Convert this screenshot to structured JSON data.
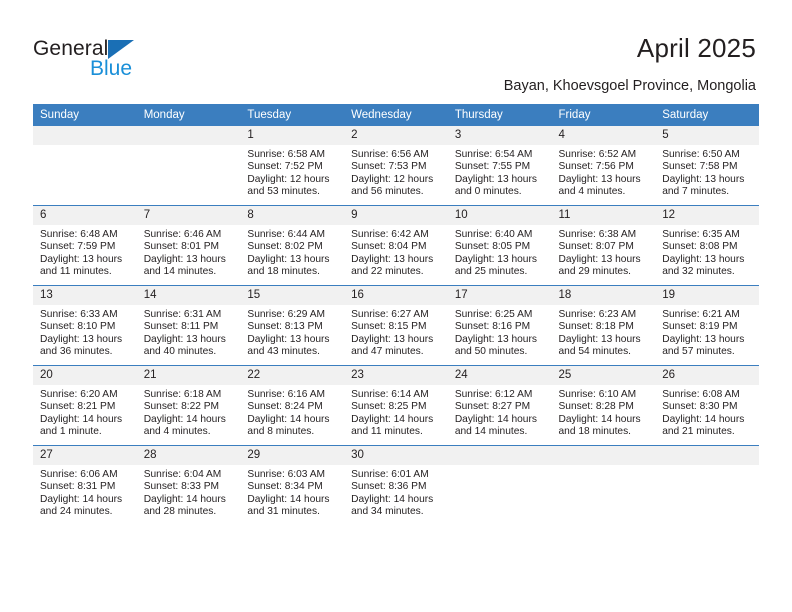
{
  "brand": {
    "name_part1": "General",
    "name_part2": "Blue",
    "triangle_icon": "triangle-icon",
    "colors": {
      "general_text": "#231f20",
      "blue_text": "#1a8fd8",
      "triangle": "#1a6fb5"
    }
  },
  "header": {
    "title": "April 2025",
    "subtitle": "Bayan, Khoevsgoel Province, Mongolia"
  },
  "calendar": {
    "header_bg": "#3b7ebf",
    "daynum_bg": "#f1f1f1",
    "weekday_headers": [
      "Sunday",
      "Monday",
      "Tuesday",
      "Wednesday",
      "Thursday",
      "Friday",
      "Saturday"
    ],
    "weeks": [
      [
        {
          "day": "",
          "blank": true,
          "sunrise": "",
          "sunset": "",
          "daylight_line1": "",
          "daylight_line2": ""
        },
        {
          "day": "",
          "blank": true,
          "sunrise": "",
          "sunset": "",
          "daylight_line1": "",
          "daylight_line2": ""
        },
        {
          "day": "1",
          "blank": false,
          "sunrise": "Sunrise: 6:58 AM",
          "sunset": "Sunset: 7:52 PM",
          "daylight_line1": "Daylight: 12 hours",
          "daylight_line2": "and 53 minutes."
        },
        {
          "day": "2",
          "blank": false,
          "sunrise": "Sunrise: 6:56 AM",
          "sunset": "Sunset: 7:53 PM",
          "daylight_line1": "Daylight: 12 hours",
          "daylight_line2": "and 56 minutes."
        },
        {
          "day": "3",
          "blank": false,
          "sunrise": "Sunrise: 6:54 AM",
          "sunset": "Sunset: 7:55 PM",
          "daylight_line1": "Daylight: 13 hours",
          "daylight_line2": "and 0 minutes."
        },
        {
          "day": "4",
          "blank": false,
          "sunrise": "Sunrise: 6:52 AM",
          "sunset": "Sunset: 7:56 PM",
          "daylight_line1": "Daylight: 13 hours",
          "daylight_line2": "and 4 minutes."
        },
        {
          "day": "5",
          "blank": false,
          "sunrise": "Sunrise: 6:50 AM",
          "sunset": "Sunset: 7:58 PM",
          "daylight_line1": "Daylight: 13 hours",
          "daylight_line2": "and 7 minutes."
        }
      ],
      [
        {
          "day": "6",
          "blank": false,
          "sunrise": "Sunrise: 6:48 AM",
          "sunset": "Sunset: 7:59 PM",
          "daylight_line1": "Daylight: 13 hours",
          "daylight_line2": "and 11 minutes."
        },
        {
          "day": "7",
          "blank": false,
          "sunrise": "Sunrise: 6:46 AM",
          "sunset": "Sunset: 8:01 PM",
          "daylight_line1": "Daylight: 13 hours",
          "daylight_line2": "and 14 minutes."
        },
        {
          "day": "8",
          "blank": false,
          "sunrise": "Sunrise: 6:44 AM",
          "sunset": "Sunset: 8:02 PM",
          "daylight_line1": "Daylight: 13 hours",
          "daylight_line2": "and 18 minutes."
        },
        {
          "day": "9",
          "blank": false,
          "sunrise": "Sunrise: 6:42 AM",
          "sunset": "Sunset: 8:04 PM",
          "daylight_line1": "Daylight: 13 hours",
          "daylight_line2": "and 22 minutes."
        },
        {
          "day": "10",
          "blank": false,
          "sunrise": "Sunrise: 6:40 AM",
          "sunset": "Sunset: 8:05 PM",
          "daylight_line1": "Daylight: 13 hours",
          "daylight_line2": "and 25 minutes."
        },
        {
          "day": "11",
          "blank": false,
          "sunrise": "Sunrise: 6:38 AM",
          "sunset": "Sunset: 8:07 PM",
          "daylight_line1": "Daylight: 13 hours",
          "daylight_line2": "and 29 minutes."
        },
        {
          "day": "12",
          "blank": false,
          "sunrise": "Sunrise: 6:35 AM",
          "sunset": "Sunset: 8:08 PM",
          "daylight_line1": "Daylight: 13 hours",
          "daylight_line2": "and 32 minutes."
        }
      ],
      [
        {
          "day": "13",
          "blank": false,
          "sunrise": "Sunrise: 6:33 AM",
          "sunset": "Sunset: 8:10 PM",
          "daylight_line1": "Daylight: 13 hours",
          "daylight_line2": "and 36 minutes."
        },
        {
          "day": "14",
          "blank": false,
          "sunrise": "Sunrise: 6:31 AM",
          "sunset": "Sunset: 8:11 PM",
          "daylight_line1": "Daylight: 13 hours",
          "daylight_line2": "and 40 minutes."
        },
        {
          "day": "15",
          "blank": false,
          "sunrise": "Sunrise: 6:29 AM",
          "sunset": "Sunset: 8:13 PM",
          "daylight_line1": "Daylight: 13 hours",
          "daylight_line2": "and 43 minutes."
        },
        {
          "day": "16",
          "blank": false,
          "sunrise": "Sunrise: 6:27 AM",
          "sunset": "Sunset: 8:15 PM",
          "daylight_line1": "Daylight: 13 hours",
          "daylight_line2": "and 47 minutes."
        },
        {
          "day": "17",
          "blank": false,
          "sunrise": "Sunrise: 6:25 AM",
          "sunset": "Sunset: 8:16 PM",
          "daylight_line1": "Daylight: 13 hours",
          "daylight_line2": "and 50 minutes."
        },
        {
          "day": "18",
          "blank": false,
          "sunrise": "Sunrise: 6:23 AM",
          "sunset": "Sunset: 8:18 PM",
          "daylight_line1": "Daylight: 13 hours",
          "daylight_line2": "and 54 minutes."
        },
        {
          "day": "19",
          "blank": false,
          "sunrise": "Sunrise: 6:21 AM",
          "sunset": "Sunset: 8:19 PM",
          "daylight_line1": "Daylight: 13 hours",
          "daylight_line2": "and 57 minutes."
        }
      ],
      [
        {
          "day": "20",
          "blank": false,
          "sunrise": "Sunrise: 6:20 AM",
          "sunset": "Sunset: 8:21 PM",
          "daylight_line1": "Daylight: 14 hours",
          "daylight_line2": "and 1 minute."
        },
        {
          "day": "21",
          "blank": false,
          "sunrise": "Sunrise: 6:18 AM",
          "sunset": "Sunset: 8:22 PM",
          "daylight_line1": "Daylight: 14 hours",
          "daylight_line2": "and 4 minutes."
        },
        {
          "day": "22",
          "blank": false,
          "sunrise": "Sunrise: 6:16 AM",
          "sunset": "Sunset: 8:24 PM",
          "daylight_line1": "Daylight: 14 hours",
          "daylight_line2": "and 8 minutes."
        },
        {
          "day": "23",
          "blank": false,
          "sunrise": "Sunrise: 6:14 AM",
          "sunset": "Sunset: 8:25 PM",
          "daylight_line1": "Daylight: 14 hours",
          "daylight_line2": "and 11 minutes."
        },
        {
          "day": "24",
          "blank": false,
          "sunrise": "Sunrise: 6:12 AM",
          "sunset": "Sunset: 8:27 PM",
          "daylight_line1": "Daylight: 14 hours",
          "daylight_line2": "and 14 minutes."
        },
        {
          "day": "25",
          "blank": false,
          "sunrise": "Sunrise: 6:10 AM",
          "sunset": "Sunset: 8:28 PM",
          "daylight_line1": "Daylight: 14 hours",
          "daylight_line2": "and 18 minutes."
        },
        {
          "day": "26",
          "blank": false,
          "sunrise": "Sunrise: 6:08 AM",
          "sunset": "Sunset: 8:30 PM",
          "daylight_line1": "Daylight: 14 hours",
          "daylight_line2": "and 21 minutes."
        }
      ],
      [
        {
          "day": "27",
          "blank": false,
          "sunrise": "Sunrise: 6:06 AM",
          "sunset": "Sunset: 8:31 PM",
          "daylight_line1": "Daylight: 14 hours",
          "daylight_line2": "and 24 minutes."
        },
        {
          "day": "28",
          "blank": false,
          "sunrise": "Sunrise: 6:04 AM",
          "sunset": "Sunset: 8:33 PM",
          "daylight_line1": "Daylight: 14 hours",
          "daylight_line2": "and 28 minutes."
        },
        {
          "day": "29",
          "blank": false,
          "sunrise": "Sunrise: 6:03 AM",
          "sunset": "Sunset: 8:34 PM",
          "daylight_line1": "Daylight: 14 hours",
          "daylight_line2": "and 31 minutes."
        },
        {
          "day": "30",
          "blank": false,
          "sunrise": "Sunrise: 6:01 AM",
          "sunset": "Sunset: 8:36 PM",
          "daylight_line1": "Daylight: 14 hours",
          "daylight_line2": "and 34 minutes."
        },
        {
          "day": "",
          "blank": true,
          "sunrise": "",
          "sunset": "",
          "daylight_line1": "",
          "daylight_line2": ""
        },
        {
          "day": "",
          "blank": true,
          "sunrise": "",
          "sunset": "",
          "daylight_line1": "",
          "daylight_line2": ""
        },
        {
          "day": "",
          "blank": true,
          "sunrise": "",
          "sunset": "",
          "daylight_line1": "",
          "daylight_line2": ""
        }
      ]
    ]
  }
}
